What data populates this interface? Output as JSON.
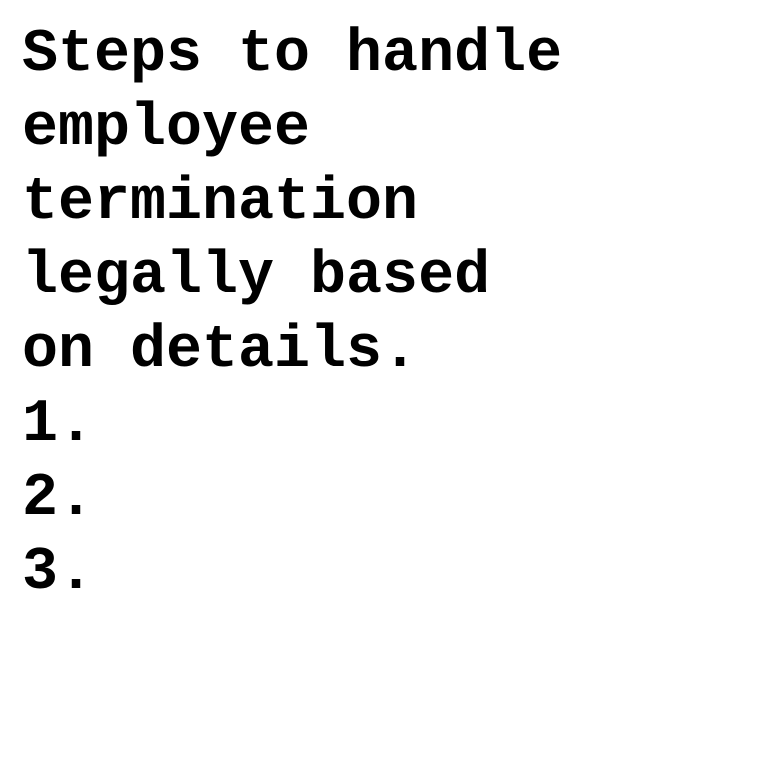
{
  "document": {
    "title_lines": [
      "Steps to handle",
      "employee",
      "termination",
      "legally based",
      "on details."
    ],
    "list_items": [
      "1.",
      "2.",
      "3."
    ]
  }
}
